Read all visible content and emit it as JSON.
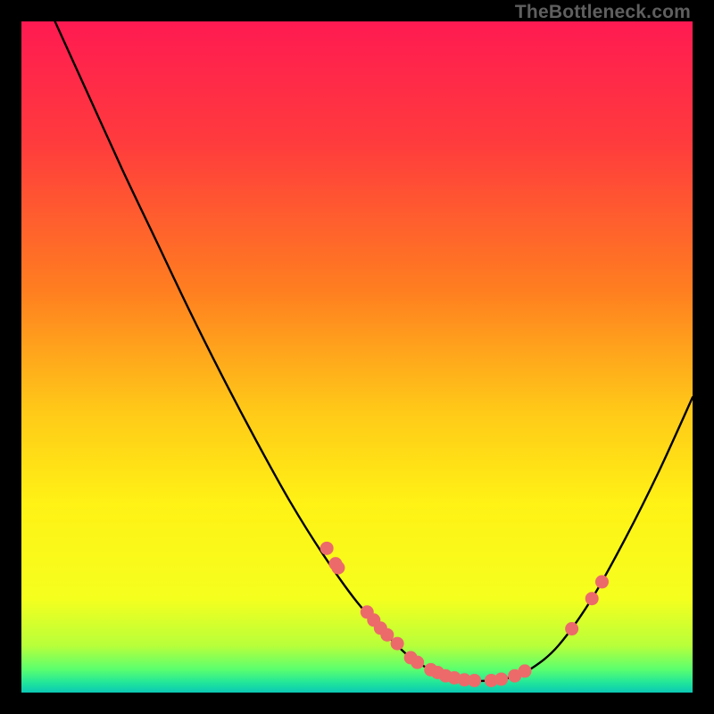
{
  "watermark": "TheBottleneck.com",
  "chart_data": {
    "type": "line",
    "title": "",
    "xlabel": "",
    "ylabel": "",
    "xlim": [
      0,
      100
    ],
    "ylim": [
      0,
      100
    ],
    "grid": false,
    "legend": false,
    "gradient_stops": [
      {
        "offset": 0.0,
        "color": "#ff1a52"
      },
      {
        "offset": 0.18,
        "color": "#ff3b3d"
      },
      {
        "offset": 0.4,
        "color": "#ff7e20"
      },
      {
        "offset": 0.58,
        "color": "#ffc918"
      },
      {
        "offset": 0.72,
        "color": "#fff215"
      },
      {
        "offset": 0.86,
        "color": "#f5ff1e"
      },
      {
        "offset": 0.93,
        "color": "#b8ff3a"
      },
      {
        "offset": 0.965,
        "color": "#5cff6e"
      },
      {
        "offset": 0.985,
        "color": "#21e69a"
      },
      {
        "offset": 1.0,
        "color": "#0ac8b4"
      }
    ],
    "curve": [
      {
        "x": 5.0,
        "y": 100.0
      },
      {
        "x": 10.0,
        "y": 89.0
      },
      {
        "x": 15.0,
        "y": 78.0
      },
      {
        "x": 20.0,
        "y": 67.5
      },
      {
        "x": 25.0,
        "y": 57.0
      },
      {
        "x": 30.0,
        "y": 47.0
      },
      {
        "x": 35.0,
        "y": 37.5
      },
      {
        "x": 40.0,
        "y": 28.5
      },
      {
        "x": 45.0,
        "y": 20.5
      },
      {
        "x": 50.0,
        "y": 13.5
      },
      {
        "x": 55.0,
        "y": 8.0
      },
      {
        "x": 58.0,
        "y": 5.2
      },
      {
        "x": 61.0,
        "y": 3.4
      },
      {
        "x": 64.0,
        "y": 2.3
      },
      {
        "x": 67.0,
        "y": 1.8
      },
      {
        "x": 70.0,
        "y": 1.8
      },
      {
        "x": 73.0,
        "y": 2.3
      },
      {
        "x": 76.0,
        "y": 3.6
      },
      {
        "x": 80.0,
        "y": 7.0
      },
      {
        "x": 85.0,
        "y": 14.0
      },
      {
        "x": 90.0,
        "y": 23.0
      },
      {
        "x": 95.0,
        "y": 33.0
      },
      {
        "x": 100.0,
        "y": 44.0
      }
    ],
    "scatter": [
      {
        "x": 45.5,
        "y": 21.5
      },
      {
        "x": 46.8,
        "y": 19.2
      },
      {
        "x": 47.2,
        "y": 18.6
      },
      {
        "x": 51.5,
        "y": 12.0
      },
      {
        "x": 52.5,
        "y": 10.8
      },
      {
        "x": 53.5,
        "y": 9.6
      },
      {
        "x": 54.5,
        "y": 8.6
      },
      {
        "x": 56.0,
        "y": 7.3
      },
      {
        "x": 58.0,
        "y": 5.2
      },
      {
        "x": 59.0,
        "y": 4.5
      },
      {
        "x": 61.0,
        "y": 3.4
      },
      {
        "x": 62.0,
        "y": 3.0
      },
      {
        "x": 63.2,
        "y": 2.5
      },
      {
        "x": 64.5,
        "y": 2.2
      },
      {
        "x": 66.0,
        "y": 1.9
      },
      {
        "x": 67.5,
        "y": 1.8
      },
      {
        "x": 70.0,
        "y": 1.8
      },
      {
        "x": 71.5,
        "y": 2.0
      },
      {
        "x": 73.5,
        "y": 2.5
      },
      {
        "x": 75.0,
        "y": 3.2
      },
      {
        "x": 82.0,
        "y": 9.5
      },
      {
        "x": 85.0,
        "y": 14.0
      },
      {
        "x": 86.5,
        "y": 16.5
      }
    ],
    "scatter_color": "#ec6a6a",
    "curve_color": "#000000"
  }
}
